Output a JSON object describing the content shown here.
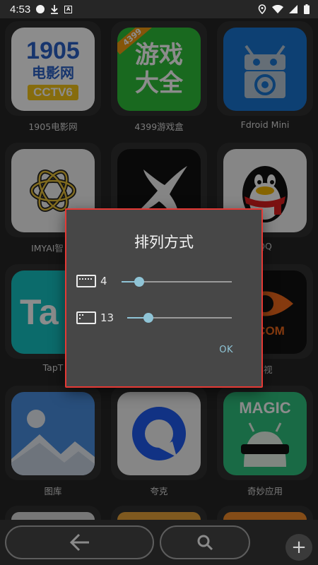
{
  "status_bar": {
    "time": "4:53"
  },
  "apps": [
    {
      "label": "1905电影网",
      "icon_name": "1905-movie-icon",
      "icon_text": [
        "1905",
        "电影网",
        "CCTV6"
      ]
    },
    {
      "label": "4399游戏盒",
      "icon_name": "4399-game-box-icon",
      "icon_text": [
        "游戏",
        "大全",
        "4399"
      ]
    },
    {
      "label": "Fdroid Mini",
      "icon_name": "fdroid-icon"
    },
    {
      "label": "IMYAI智",
      "icon_name": "openai-knot-icon"
    },
    {
      "label": "",
      "icon_name": "star-shape-icon"
    },
    {
      "label": "QQ",
      "icon_name": "qq-penguin-icon"
    },
    {
      "label": "TapT",
      "icon_name": "taptap-icon",
      "icon_text": [
        "Ta"
      ]
    },
    {
      "label": "",
      "icon_name": "blank-app-icon"
    },
    {
      "label": "影视",
      "icon_name": "video-site-icon",
      "icon_text": [
        "S.COM"
      ]
    },
    {
      "label": "图库",
      "icon_name": "gallery-icon"
    },
    {
      "label": "夸克",
      "icon_name": "quark-icon"
    },
    {
      "label": "奇妙应用",
      "icon_name": "magic-app-icon",
      "icon_text": [
        "MAGIC"
      ]
    }
  ],
  "dialog": {
    "title": "排列方式",
    "rows": [
      {
        "icon": "columns-grid-icon",
        "value": "4",
        "level": 0.16
      },
      {
        "icon": "rows-list-icon",
        "value": "13",
        "level": 0.2
      }
    ],
    "ok_label": "OK",
    "border_color": "#e53935",
    "accent": "#8fc4d6"
  },
  "bottom_bar": {
    "back_icon": "arrow-left-icon",
    "search_icon": "search-icon",
    "add_icon": "plus-icon",
    "add_label": "+"
  }
}
